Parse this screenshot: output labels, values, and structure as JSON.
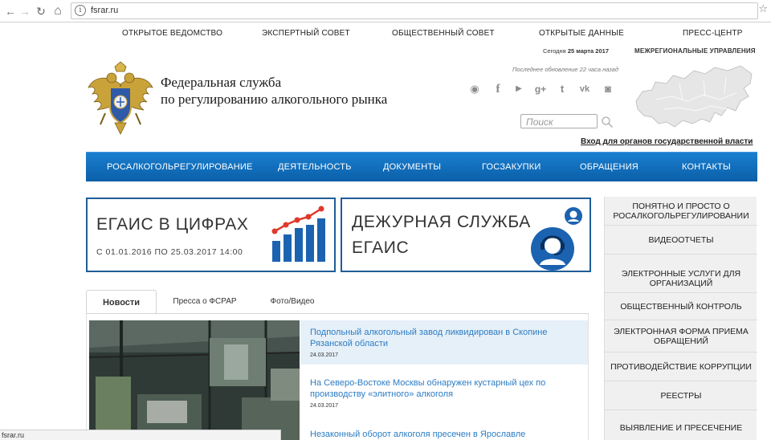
{
  "browser": {
    "url": "fsrar.ru",
    "back": "←",
    "forward": "→",
    "reload": "↻",
    "home": "⌂",
    "info": "i",
    "star": "☆",
    "status_url": "fsrar.ru"
  },
  "top_links": [
    {
      "label": "ОТКРЫТОЕ ВЕДОМСТВО"
    },
    {
      "label": "ЭКСПЕРТНЫЙ СОВЕТ"
    },
    {
      "label": "ОБЩЕСТВЕННЫЙ СОВЕТ"
    },
    {
      "label": "ОТКРЫТЫЕ ДАННЫЕ"
    },
    {
      "label": "ПРЕСС-ЦЕНТР"
    }
  ],
  "header": {
    "date_prefix": "Сегодня",
    "date": "25 марта 2017",
    "regional_label": "МЕЖРЕГИОНАЛЬНЫЕ УПРАВЛЕНИЯ",
    "updated": "Последнее обновление 22 часа назад",
    "org_line1": "Федеральная служба",
    "org_line2": "по регулированию алкогольного рынка",
    "search_placeholder": "Поиск",
    "gov_login": "Вход для органов государственной власти",
    "social_icons": [
      "eye-icon",
      "facebook-icon",
      "youtube-icon",
      "googleplus-icon",
      "twitter-icon",
      "vk-icon",
      "instagram-icon"
    ],
    "social_glyphs": [
      "◉",
      "f",
      "▶",
      "g+",
      "t",
      "vk",
      "◙"
    ]
  },
  "main_nav": [
    {
      "label": "РОСАЛКОГОЛЬРЕГУЛИРОВАНИЕ"
    },
    {
      "label": "ДЕЯТЕЛЬНОСТЬ"
    },
    {
      "label": "ДОКУМЕНТЫ"
    },
    {
      "label": "ГОСЗАКУПКИ"
    },
    {
      "label": "ОБРАЩЕНИЯ"
    },
    {
      "label": "КОНТАКТЫ"
    }
  ],
  "banners": {
    "stats_title": "ЕГАИС В ЦИФРАХ",
    "stats_period": "С 01.01.2016 ПО 25.03.2017 14:00",
    "duty_title_line1": "ДЕЖУРНАЯ СЛУЖБА",
    "duty_title_line2": "ЕГАИС"
  },
  "sidebar": [
    {
      "label": "ПОНЯТНО И ПРОСТО О РОСАЛКОГОЛЬРЕГУЛИРОВАНИИ"
    },
    {
      "label": "ВИДЕООТЧЕТЫ"
    },
    {
      "label": "ЭЛЕКТРОННЫЕ УСЛУГИ ДЛЯ ОРГАНИЗАЦИЙ"
    },
    {
      "label": "ОБЩЕСТВЕННЫЙ КОНТРОЛЬ"
    },
    {
      "label": "ЭЛЕКТРОННАЯ ФОРМА ПРИЕМА ОБРАЩЕНИЙ"
    },
    {
      "label": "ПРОТИВОДЕЙСТВИЕ КОРРУПЦИИ"
    },
    {
      "label": "РЕЕСТРЫ"
    },
    {
      "label": "ВЫЯВЛЕНИЕ И ПРЕСЕЧЕНИЕ"
    }
  ],
  "tabs": [
    {
      "label": "Новости"
    },
    {
      "label": "Пресса о ФСРАР"
    },
    {
      "label": "Фото/Видео"
    }
  ],
  "news": [
    {
      "title": "Подпольный алкогольный завод ликвидирован в Скопине Рязанской области",
      "date": "24.03.2017"
    },
    {
      "title": "На Северо-Востоке Москвы обнаружен кустарный цех по производству «элитного» алкоголя",
      "date": "24.03.2017"
    },
    {
      "title": "Незаконный оборот алкоголя пресечен в Ярославле",
      "date": ""
    }
  ],
  "colors": {
    "nav_blue": "#0e67b4",
    "banner_border": "#1f5d98",
    "link_blue": "#2b7cc4",
    "chart_blue": "#1b63b0",
    "chart_red": "#e0392b"
  }
}
